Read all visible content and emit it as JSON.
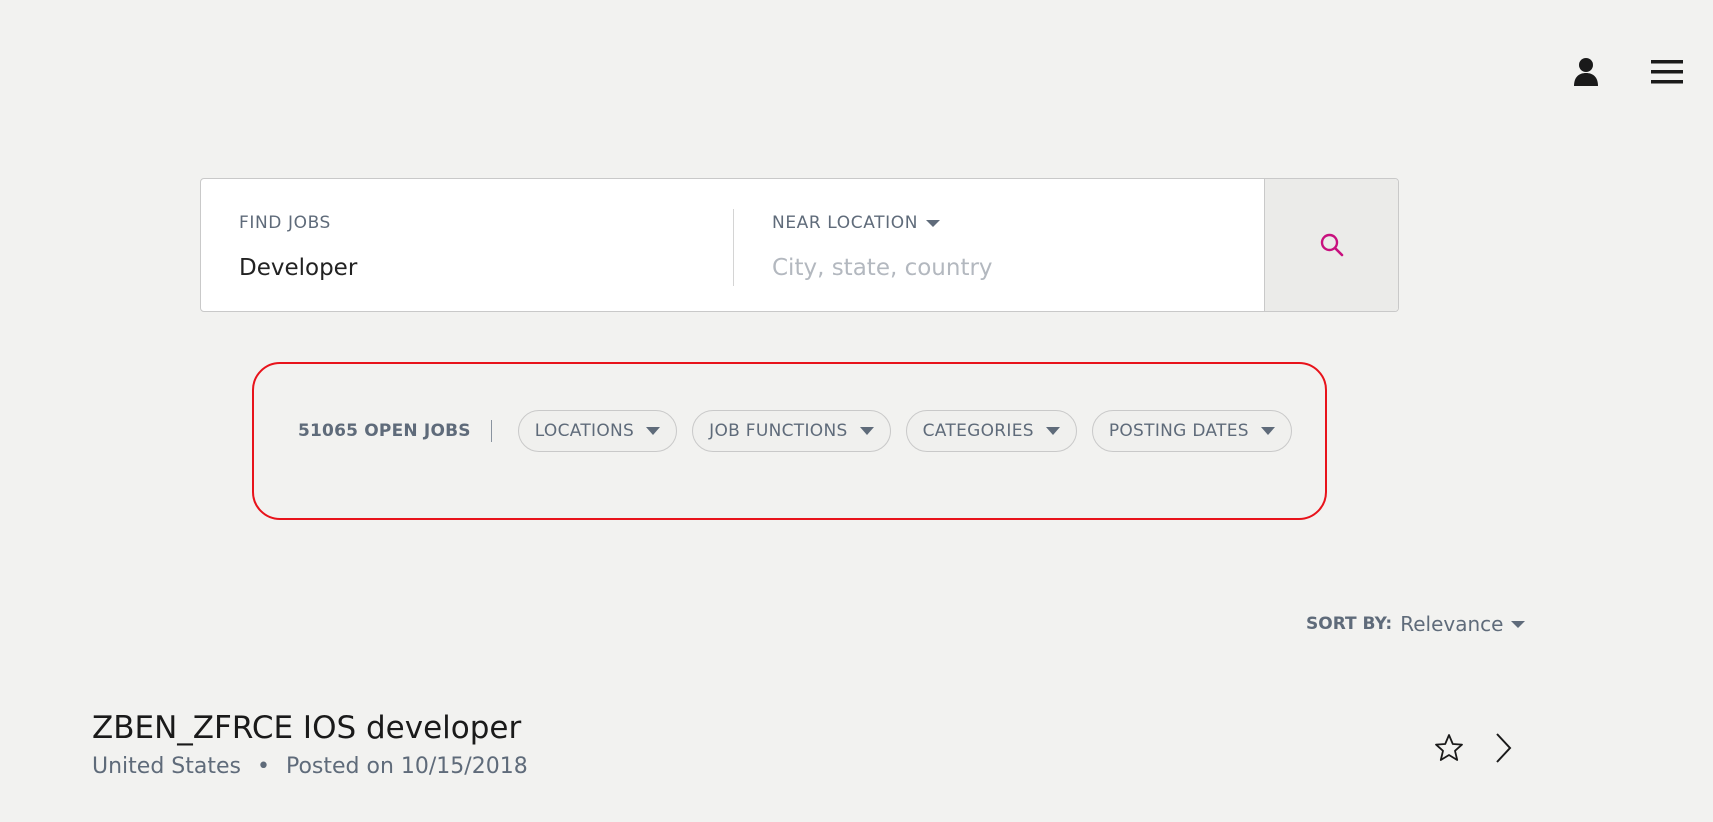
{
  "header": {
    "user_icon": "user-icon",
    "menu_icon": "hamburger-menu-icon"
  },
  "search": {
    "find_label": "FIND JOBS",
    "find_value": "Developer",
    "near_label": "NEAR LOCATION",
    "near_placeholder": "City, state, country",
    "button_icon": "search-icon",
    "accent_color": "#c8107e"
  },
  "filters": {
    "open_jobs": "51065 OPEN JOBS",
    "items": [
      {
        "label": "LOCATIONS"
      },
      {
        "label": "JOB FUNCTIONS"
      },
      {
        "label": "CATEGORIES"
      },
      {
        "label": "POSTING DATES"
      }
    ],
    "highlight_color": "#e8131b"
  },
  "sort": {
    "label": "SORT BY:",
    "value": "Relevance"
  },
  "jobs": [
    {
      "title": "ZBEN_ZFRCE IOS developer",
      "location": "United States",
      "posted": "Posted on 10/15/2018",
      "favorite_icon": "star-outline-icon",
      "open_icon": "chevron-right-icon"
    }
  ]
}
